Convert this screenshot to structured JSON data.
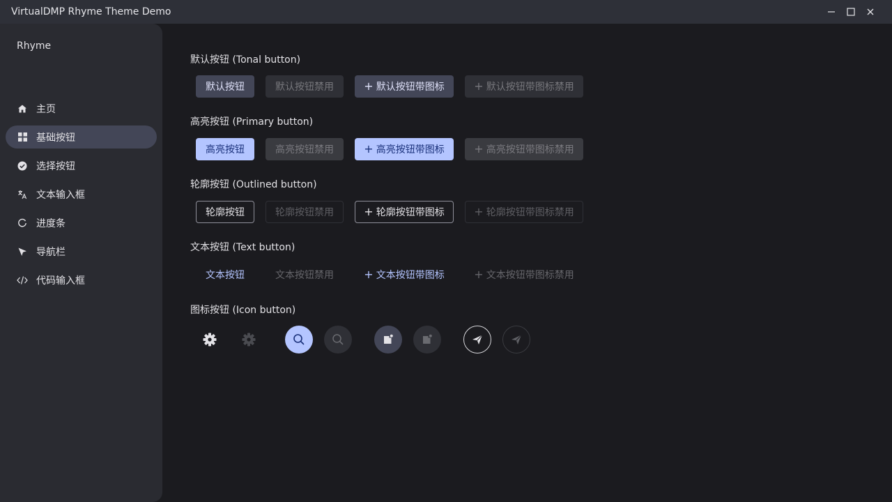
{
  "window": {
    "title": "VirtualDMP Rhyme Theme Demo",
    "controls": [
      "minimize-icon",
      "maximize-icon",
      "close-icon"
    ]
  },
  "sidebar": {
    "app_name": "Rhyme",
    "items": [
      {
        "label": "主页",
        "icon": "home-icon"
      },
      {
        "label": "基础按钮",
        "icon": "grid-icon",
        "active": true
      },
      {
        "label": "选择按钮",
        "icon": "check-circle-icon"
      },
      {
        "label": "文本输入框",
        "icon": "translate-icon"
      },
      {
        "label": "进度条",
        "icon": "progress-icon"
      },
      {
        "label": "导航栏",
        "icon": "navigation-icon"
      },
      {
        "label": "代码输入框",
        "icon": "code-icon"
      }
    ]
  },
  "sections": {
    "tonal": {
      "title": "默认按钮 (Tonal button)",
      "buttons": [
        "默认按钮",
        "默认按钮禁用",
        "默认按钮带图标",
        "默认按钮带图标禁用"
      ]
    },
    "primary": {
      "title": "高亮按钮 (Primary button)",
      "buttons": [
        "高亮按钮",
        "高亮按钮禁用",
        "高亮按钮带图标",
        "高亮按钮带图标禁用"
      ]
    },
    "outlined": {
      "title": "轮廓按钮 (Outlined button)",
      "buttons": [
        "轮廓按钮",
        "轮廓按钮禁用",
        "轮廓按钮带图标",
        "轮廓按钮带图标禁用"
      ]
    },
    "text": {
      "title": "文本按钮 (Text button)",
      "buttons": [
        "文本按钮",
        "文本按钮禁用",
        "文本按钮带图标",
        "文本按钮带图标禁用"
      ]
    },
    "icon": {
      "title": "图标按钮 (Icon button)",
      "buttons": [
        "gear-icon",
        "gear-icon-disabled",
        "search-icon",
        "search-icon-disabled",
        "note-icon",
        "note-icon-disabled",
        "send-icon",
        "send-icon-disabled"
      ]
    }
  },
  "icons": {
    "plus": "+"
  },
  "colors": {
    "background": "#1b1b1f",
    "sidebar": "#2a2b31",
    "titlebar": "#2e3038",
    "accent": "#b4c5ff",
    "tonal": "#434657"
  }
}
